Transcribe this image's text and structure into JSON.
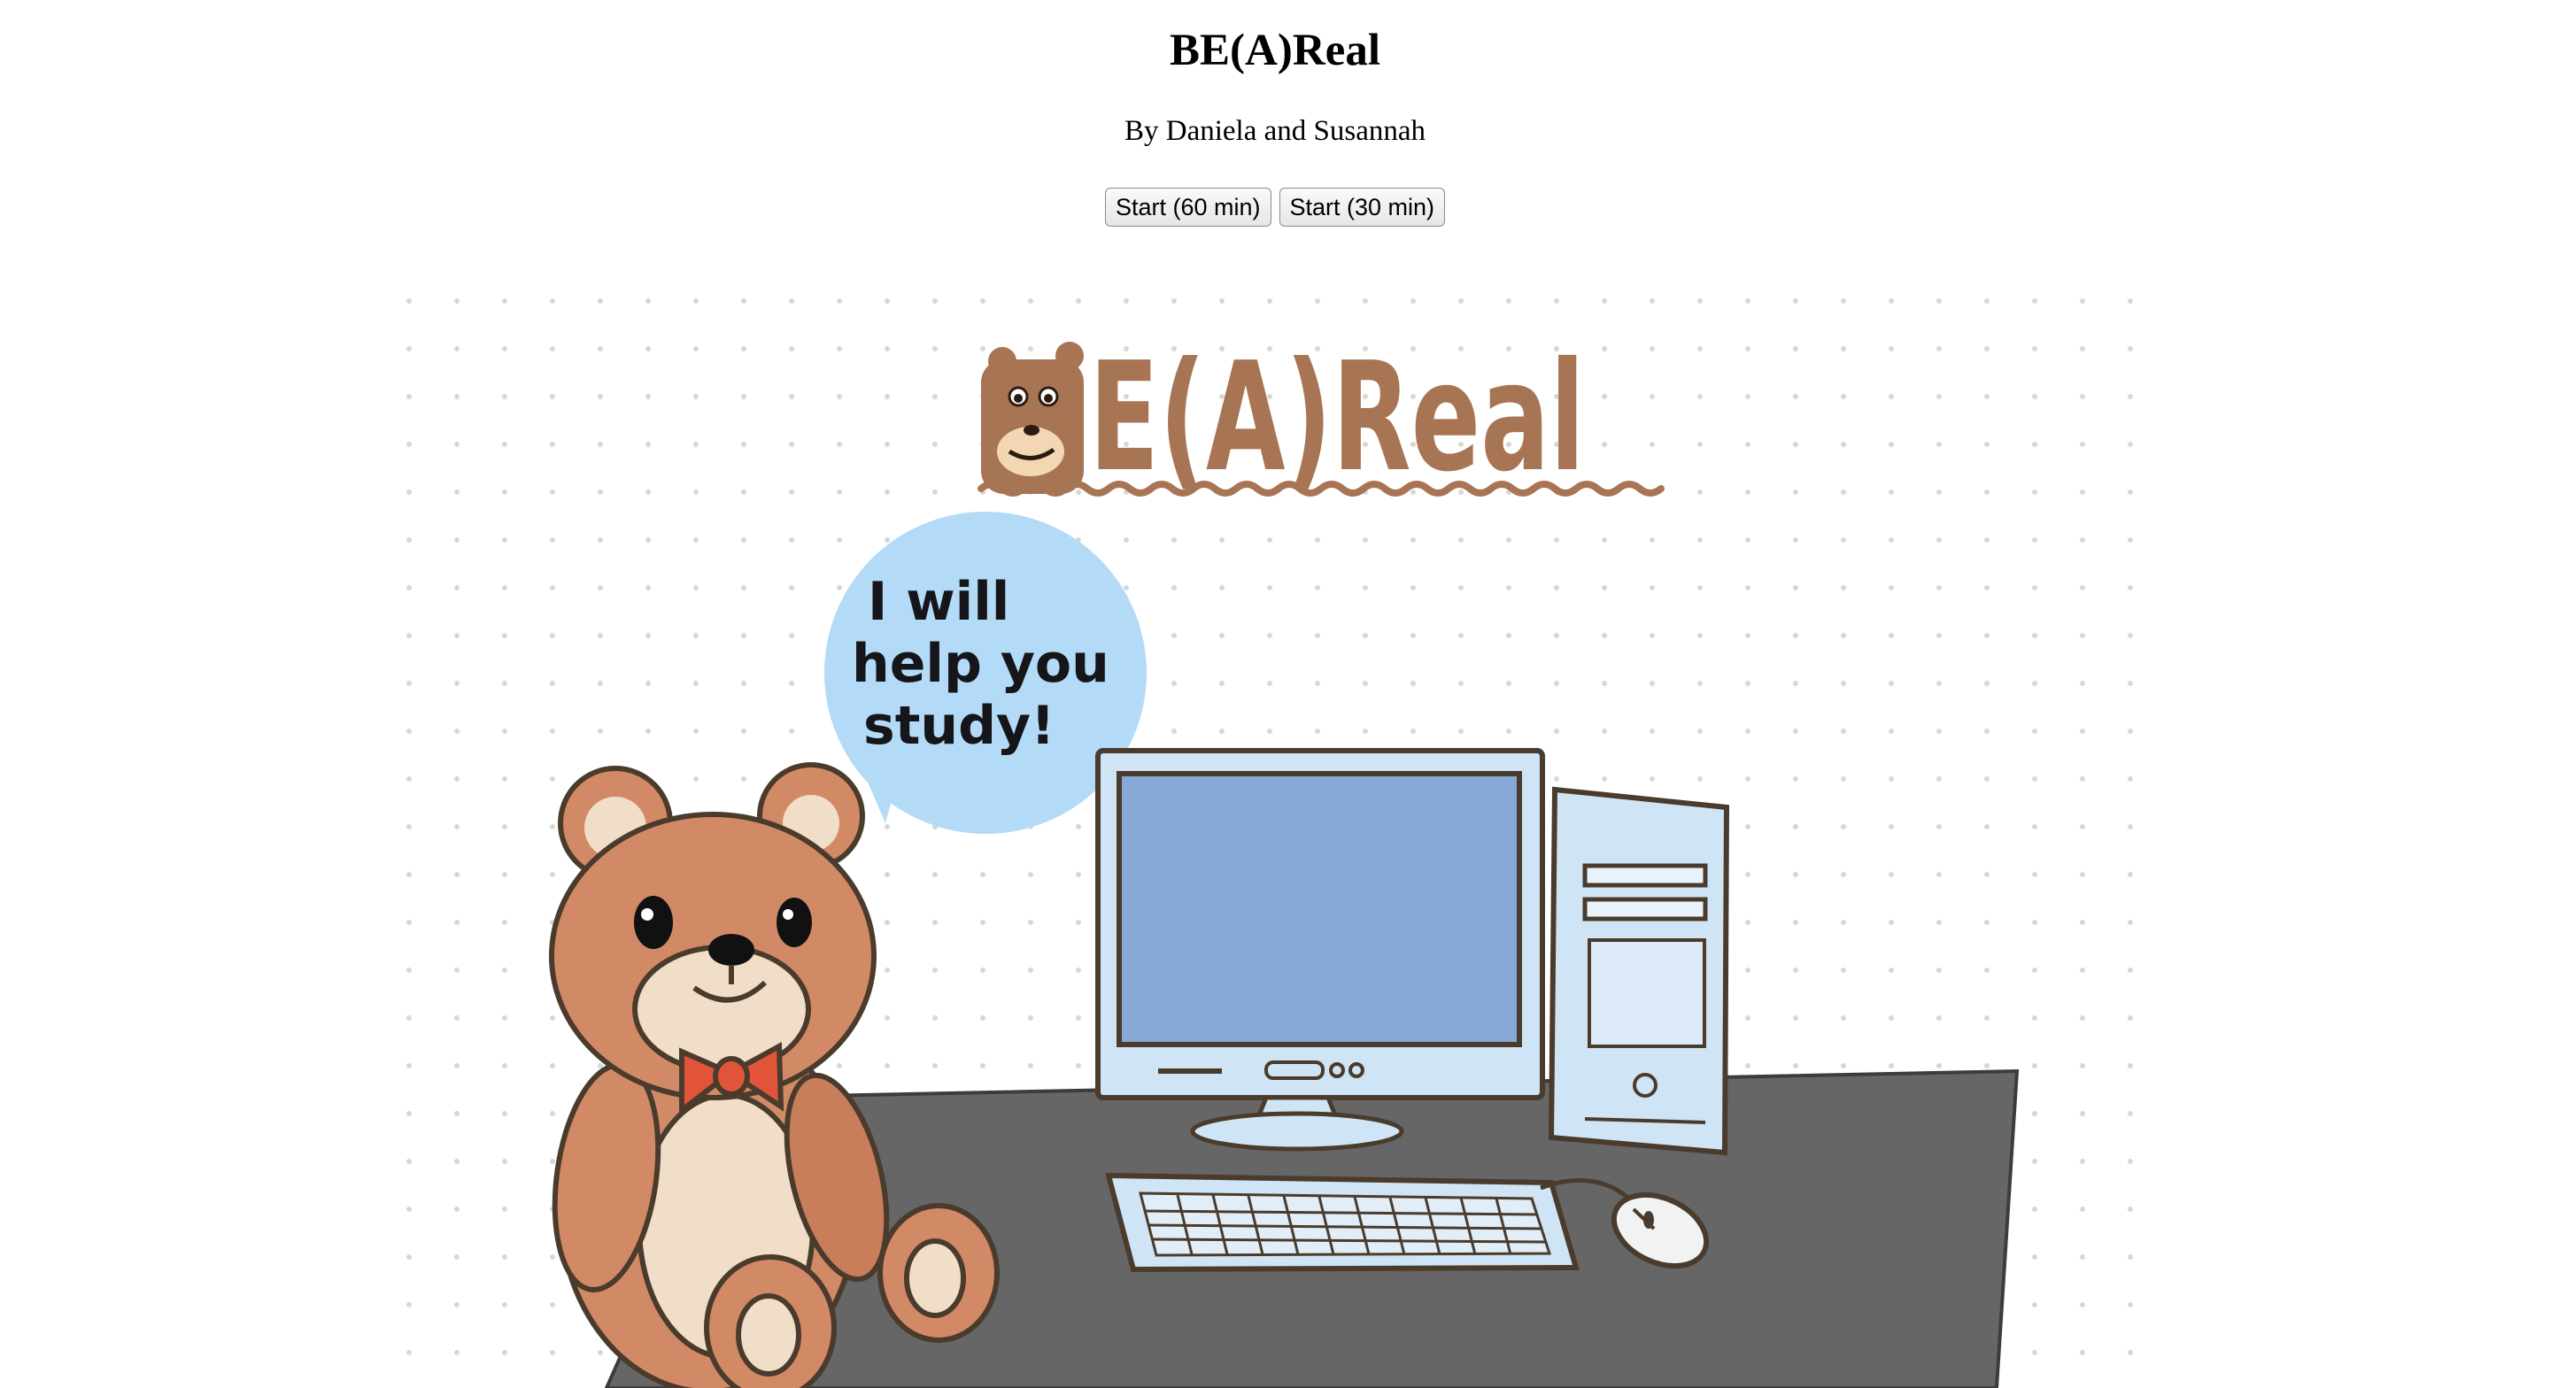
{
  "header": {
    "title": "BE(A)Real",
    "byline": "By Daniela and Susannah"
  },
  "buttons": {
    "start_60": "Start (60 min)",
    "start_30": "Start (30 min)"
  },
  "illustration": {
    "logo_text": "E(A)Real",
    "speech_bubble": [
      "I will",
      "help you",
      "study!"
    ],
    "colors": {
      "bear_fur": "#d28a66",
      "bear_belly": "#f1dec8",
      "bow_tie": "#e2543a",
      "bubble": "#b3dbf7",
      "monitor_screen": "#86a9d8",
      "computer_body": "#cfe5f5",
      "desk": "#666666",
      "logo_brown": "#a87554",
      "outline": "#4a3b2c"
    },
    "icons": [
      "bear-logo-icon",
      "teddy-bear",
      "computer-monitor",
      "computer-tower",
      "keyboard",
      "mouse"
    ]
  }
}
